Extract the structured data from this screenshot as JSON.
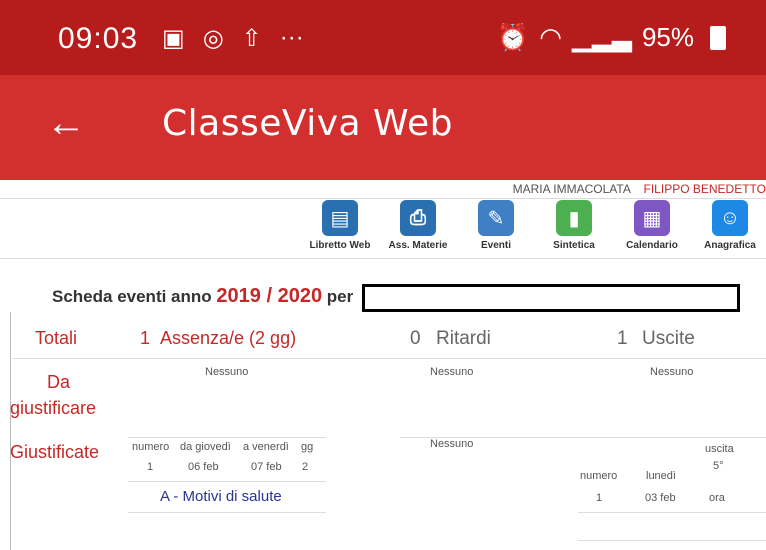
{
  "status": {
    "time": "09:03",
    "battery": "95%"
  },
  "app": {
    "title": "ClasseViva Web"
  },
  "users": {
    "user1": "MARIA IMMACOLATA",
    "user2": "FILIPPO BENEDETTO"
  },
  "toolbar": [
    {
      "label": "Libretto Web",
      "color": "#2a6fb0",
      "glyph": "▤"
    },
    {
      "label": "Ass. Materie",
      "color": "#2a6fb0",
      "glyph": "⎙"
    },
    {
      "label": "Eventi",
      "color": "#3f7fc4",
      "glyph": "✎"
    },
    {
      "label": "Sintetica",
      "color": "#4caf50",
      "glyph": "▮"
    },
    {
      "label": "Calendario",
      "color": "#7e57c2",
      "glyph": "▦"
    },
    {
      "label": "Anagrafica",
      "color": "#1e88e5",
      "glyph": "☺"
    }
  ],
  "heading": {
    "prefix": "Scheda eventi anno",
    "year": "2019 / 2020",
    "suffix": "per"
  },
  "rows": {
    "totali_label": "Totali",
    "da_label_1": "Da",
    "da_label_2": "giustificare",
    "giust_label": "Giustificate"
  },
  "totals": {
    "assenze_num": "1",
    "assenze_label": "Assenza/e (2 gg)",
    "ritardi_num": "0",
    "ritardi_label": "Ritardi",
    "uscite_num": "1",
    "uscite_label": "Uscite"
  },
  "da_giustificare": {
    "col1": "Nessuno",
    "col2": "Nessuno",
    "col3": "Nessuno"
  },
  "giustificate": {
    "assenze": {
      "headers": [
        "numero",
        "da giovedì",
        "a venerdì",
        "gg"
      ],
      "values": [
        "1",
        "06 feb",
        "07 feb",
        "2"
      ],
      "motivo": "A - Motivi di salute"
    },
    "ritardi": "Nessuno",
    "uscite": {
      "uscita_header": "uscita",
      "uscita_sub": "5°",
      "headers": [
        "numero",
        "lunedì",
        "ora"
      ],
      "values": [
        "1",
        "03 feb"
      ]
    }
  }
}
